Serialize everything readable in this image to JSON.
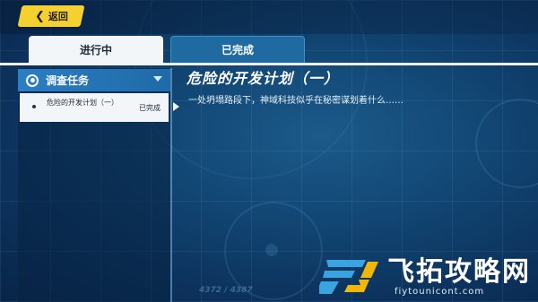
{
  "header": {
    "back_label": "返回"
  },
  "tabs": [
    {
      "label": "进行中",
      "active": true
    },
    {
      "label": "已完成",
      "active": false
    }
  ],
  "sidebar": {
    "category": {
      "label": "调查任务",
      "icon": "target-icon",
      "expanded": true
    },
    "quests": [
      {
        "title": "危险的开发计划（一）",
        "status": "已完成",
        "selected": true
      }
    ]
  },
  "detail": {
    "title": "危险的开发计划（一）",
    "description": "一处坍塌路段下，神域科技似乎在秘密谋划着什么……"
  },
  "background": {
    "faded_number": "4372 / 4387"
  },
  "watermark": {
    "site_name": "飞拓攻略网",
    "url": "fiytounicont.com"
  },
  "colors": {
    "back_button": "#f4d12f",
    "tab_active_bg": "#f3f6f9",
    "tab_inactive_bg": "#1f6aa0",
    "category_header": "#2a7fc2",
    "background": "#134a78"
  }
}
